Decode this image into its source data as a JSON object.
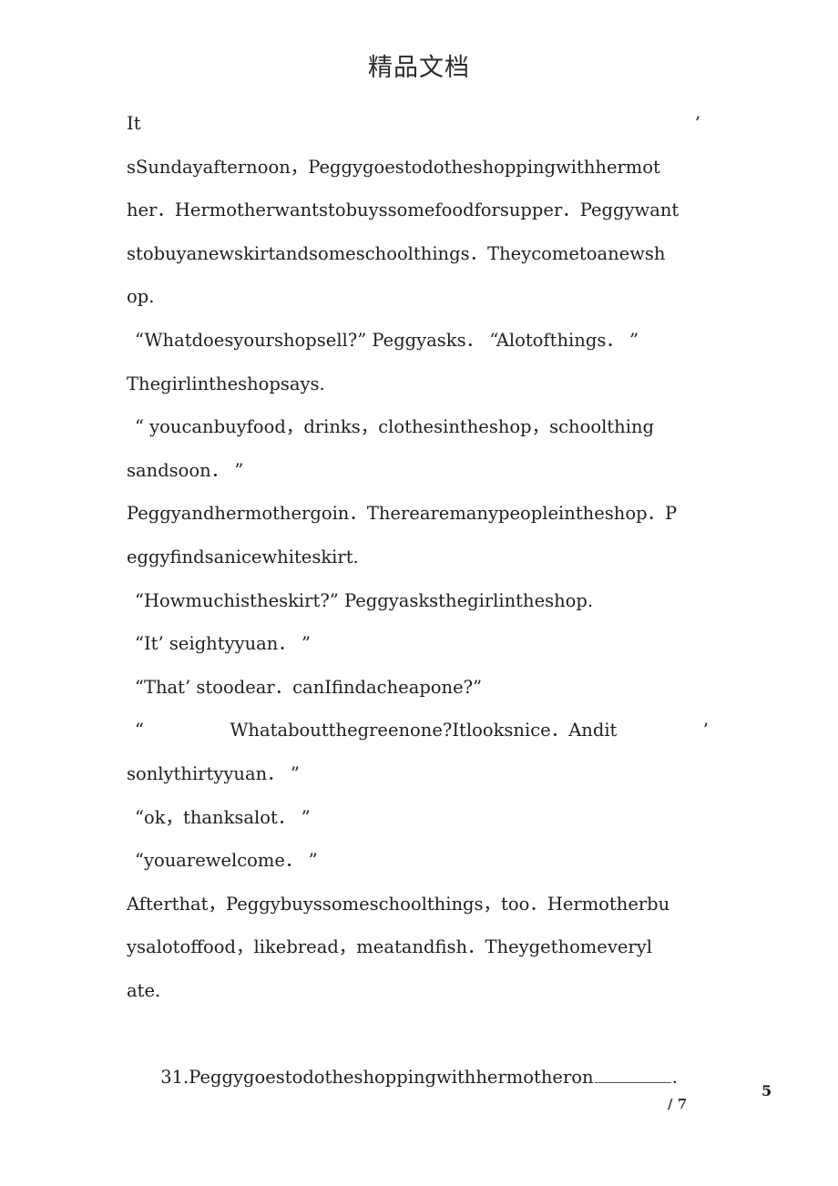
{
  "document": {
    "header_title": "精品文档",
    "page_number_current": "5",
    "page_number_total": "/ 7"
  },
  "lines": [
    {
      "id": "l1",
      "left": "It",
      "right": "’",
      "style": "justify"
    },
    {
      "id": "l2",
      "text": "sSundayafternoon，Peggygoestodotheshoppingwithhermot"
    },
    {
      "id": "l3",
      "text": "her．Hermotherwantstobuyssomefoodforsupper．Peggywant"
    },
    {
      "id": "l4",
      "text": "stobuyanewskirtandsomeschoolthings．Theycometoanewsh"
    },
    {
      "id": "l5",
      "text": "op."
    },
    {
      "id": "l6",
      "text": "“Whatdoesyourshopsell?” Peggyasks． “Alotofthings． ”",
      "style": "indent"
    },
    {
      "id": "l7",
      "text": "Thegirlintheshopsays."
    },
    {
      "id": "l8",
      "text": "“ youcanbuyfood，drinks，clothesintheshop，schoolthing",
      "style": "indent"
    },
    {
      "id": "l9",
      "text": "sandsoon． ”"
    },
    {
      "id": "l10",
      "text": "Peggyandhermothergoin．Therearemanypeopleintheshop．P"
    },
    {
      "id": "l11",
      "text": "eggyfindsanicewhiteskirt."
    },
    {
      "id": "l12",
      "text": "“Howmuchistheskirt?” Peggyasksthegirlintheshop.",
      "style": "indent"
    },
    {
      "id": "l13",
      "text": "“It’ seightyyuan． ”",
      "style": "indent"
    },
    {
      "id": "l14",
      "text": "“That’ stoodear．canIfindacheapone?”",
      "style": "indent"
    },
    {
      "id": "l15",
      "left": "“",
      "middle": "Whataboutthegreenone?Itlooksnice．Andit",
      "right": "’",
      "style": "justify-three"
    },
    {
      "id": "l16",
      "text": "sonlythirtyyuan． ”"
    },
    {
      "id": "l17",
      "text": "“ok，thanksalot． ”",
      "style": "indent"
    },
    {
      "id": "l18",
      "text": "“youarewelcome． ”",
      "style": "indent"
    },
    {
      "id": "l19",
      "text": "Afterthat，Peggybuyssomeschoolthings，too．Hermotherbu"
    },
    {
      "id": "l20",
      "text": "ysalotoffood，likebread，meatandfish．Theygethomeveryl"
    },
    {
      "id": "l21",
      "text": "ate."
    },
    {
      "id": "l22",
      "prefix": "31.Peggygoestodotheshoppingwithhermotheron",
      "suffix": ".",
      "style": "blank"
    }
  ]
}
